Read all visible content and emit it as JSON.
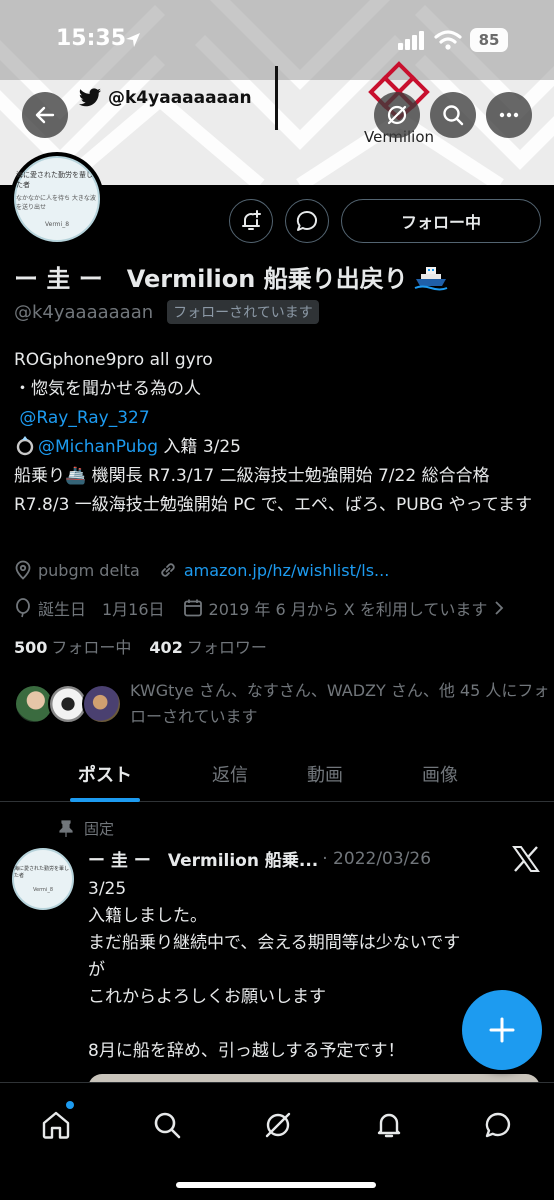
{
  "status_bar": {
    "time": "15:35",
    "battery": "85"
  },
  "banner": {
    "handle": "@k4yaaaaaaan",
    "brand_name": "Vermilion"
  },
  "profile": {
    "display_name": "ー 圭 ー　Vermilion 船乗り出戻り",
    "handle": "@k4yaaaaaaan",
    "follows_you": "フォローされています",
    "follow_button": "フォロー中",
    "avatar_text": {
      "line1": "海に愛された勤労を輩した者",
      "line2": "なかなかに人を待ち 大きな波を送り出せ",
      "line3": "Vermi_8"
    },
    "bio": {
      "line1": "ROGphone9pro all gyro",
      "line2": "・惚気を聞かせる為の人",
      "mention1": "@Ray_Ray_327",
      "mention2": "@MichanPubg",
      "line4_suffix": " 入籍 3/25",
      "line5": "船乗り🚢 機関長 R7.3/17 二級海技士勉強開始 7/22 総合合格 R7.8/3 一級海技士勉強開始 PC で、エペ、ばろ、PUBG やってます"
    },
    "location": "pubgm delta",
    "website": "amazon.jp/hz/wishlist/ls...",
    "birthday": "誕生日　1月16日",
    "joined": "2019 年 6 月から X を利用しています",
    "following_count": "500",
    "following_label": "フォロー中",
    "followers_count": "402",
    "followers_label": "フォロワー",
    "followers_you_know": "KWGtye さん、なすさん、WADZY さん、他 45 人にフォローされています"
  },
  "tabs": [
    {
      "label": "ポスト",
      "active": true
    },
    {
      "label": "返信",
      "active": false
    },
    {
      "label": "動画",
      "active": false
    },
    {
      "label": "画像",
      "active": false
    }
  ],
  "pinned_post": {
    "pinned_label": "固定",
    "author": "ー 圭 ー　Vermilion 船乗...",
    "date": "· 2022/03/26",
    "lines": [
      "3/25",
      "入籍しました。",
      "まだ船乗り継続中で、会える期間等は少ないです",
      "が",
      "これからよろしくお願いします",
      "",
      "8月に船を辞め、引っ越しする予定です！"
    ]
  },
  "colors": {
    "accent": "#1d9bf0",
    "background": "#000000",
    "text_primary": "#e7e9ea",
    "text_secondary": "#71767b",
    "brand_red": "#c8102e"
  },
  "icons": {
    "status": [
      "location-arrow-icon",
      "signal-icon",
      "wifi-icon",
      "battery-icon"
    ],
    "header": [
      "back-arrow-icon",
      "twitter-bird-icon",
      "grok-icon",
      "search-icon",
      "more-icon"
    ],
    "profile_actions": [
      "notification-add-icon",
      "message-icon"
    ],
    "nav": [
      "home-icon",
      "search-icon",
      "grok-icon",
      "bell-icon",
      "message-icon"
    ]
  }
}
